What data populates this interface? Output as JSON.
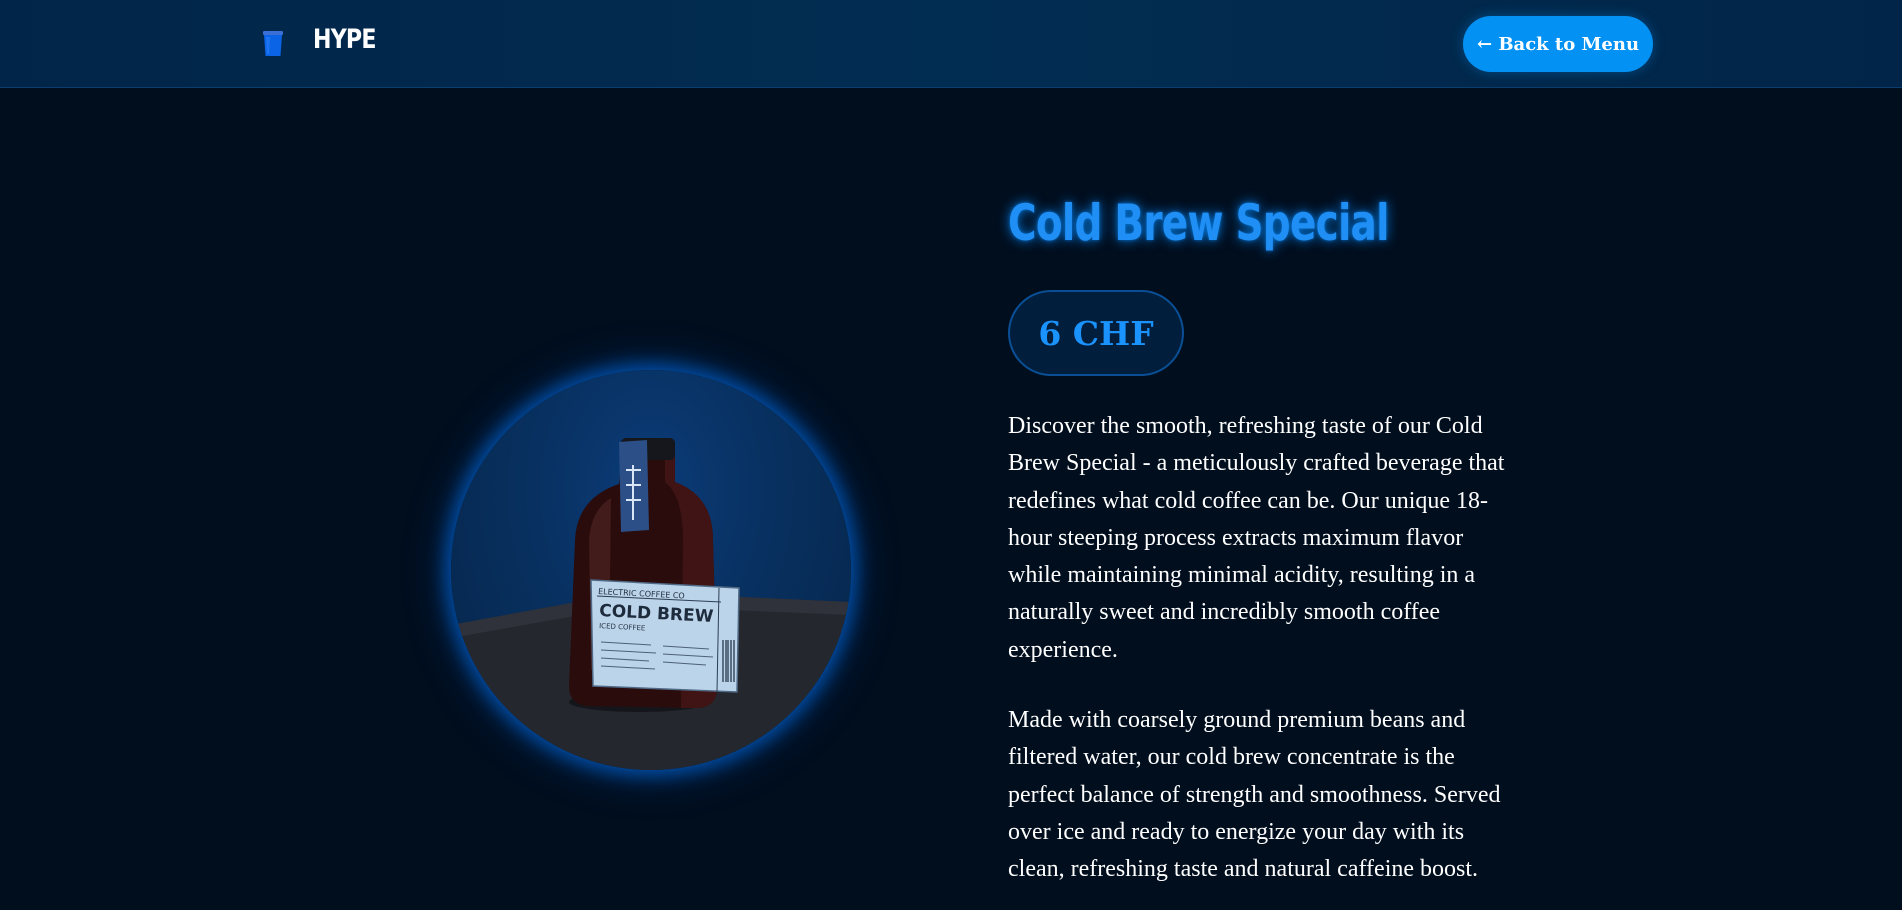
{
  "header": {
    "brand_name": "HYPE",
    "back_button_label": "← Back to Menu"
  },
  "product": {
    "title": "Cold Brew Special",
    "price": "6 CHF",
    "description_paragraphs": [
      "Discover the smooth, refreshing taste of our Cold Brew Special - a meticulously crafted beverage that redefines what cold coffee can be. Our unique 18-hour steeping process extracts maximum flavor while maintaining minimal acidity, resulting in a naturally sweet and incredibly smooth coffee experience.",
      "Made with coarsely ground premium beans and filtered water, our cold brew concentrate is the perfect balance of strength and smoothness. Served over ice and ready to energize your day with its clean, refreshing taste and natural caffeine boost."
    ],
    "image": {
      "alt": "Cold brew coffee bottle",
      "label_brand": "ELECTRIC COFFEE CO",
      "label_title": "COLD BREW",
      "label_subtitle": "ICED COFFEE"
    }
  },
  "colors": {
    "background": "#010e1e",
    "header": "#022d52",
    "accent": "#0391f3",
    "title": "#1f8ff5"
  },
  "icons": {
    "brand_icon": "coffee-cup-icon"
  }
}
